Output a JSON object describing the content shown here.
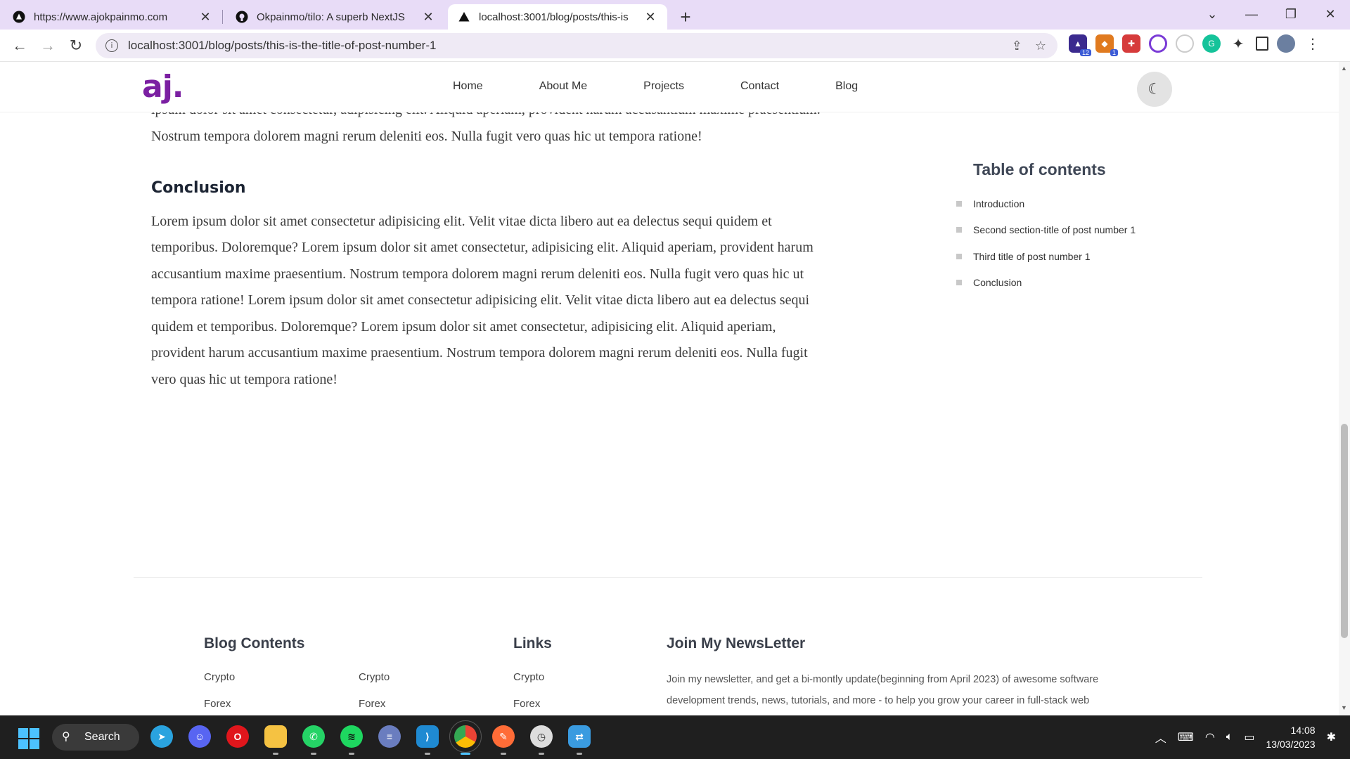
{
  "browser": {
    "tabs": [
      {
        "title": "https://www.ajokpainmo.com",
        "icon": "vercel-icon"
      },
      {
        "title": "Okpainmo/tilo: A superb NextJS",
        "icon": "github-icon"
      },
      {
        "title": "localhost:3001/blog/posts/this-is",
        "icon": "vercel-icon"
      }
    ],
    "url": "localhost:3001/blog/posts/this-is-the-title-of-post-number-1",
    "extension_badges": [
      "12",
      "1"
    ]
  },
  "site": {
    "logo": "aj.",
    "nav": [
      "Home",
      "About Me",
      "Projects",
      "Contact",
      "Blog"
    ]
  },
  "article": {
    "para_top": "ipsum dolor sit amet consectetur, adipisicing elit. Aliquid aperiam, provident harum accusantium maxime praesentium. Nostrum tempora dolorem magni rerum deleniti eos. Nulla fugit vero quas hic ut tempora ratione!",
    "conclusion_heading": "Conclusion",
    "conclusion_text": "Lorem ipsum dolor sit amet consectetur adipisicing elit. Velit vitae dicta libero aut ea delectus sequi quidem et temporibus. Doloremque? Lorem ipsum dolor sit amet consectetur, adipisicing elit. Aliquid aperiam, provident harum accusantium maxime praesentium. Nostrum tempora dolorem magni rerum deleniti eos. Nulla fugit vero quas hic ut tempora ratione! Lorem ipsum dolor sit amet consectetur adipisicing elit. Velit vitae dicta libero aut ea delectus sequi quidem et temporibus. Doloremque? Lorem ipsum dolor sit amet consectetur, adipisicing elit. Aliquid aperiam, provident harum accusantium maxime praesentium. Nostrum tempora dolorem magni rerum deleniti eos. Nulla fugit vero quas hic ut tempora ratione!"
  },
  "toc": {
    "title": "Table of contents",
    "items": [
      "Introduction",
      "Second section-title of post number 1",
      "Third title of post number 1",
      "Conclusion"
    ]
  },
  "footer": {
    "blog_contents_title": "Blog Contents",
    "blog_col1": [
      "Crypto",
      "Forex"
    ],
    "blog_col2": [
      "Crypto",
      "Forex"
    ],
    "links_title": "Links",
    "links": [
      "Crypto",
      "Forex"
    ],
    "newsletter_title": "Join My NewsLetter",
    "newsletter_text": "Join my newsletter, and get a bi-montly update(beginning from April 2023) of awesome software development trends, news, tutorials, and more - to help you grow your career in full-stack web"
  },
  "taskbar": {
    "search_label": "Search",
    "apps": [
      "telegram-icon",
      "discord-icon",
      "opera-icon",
      "file-explorer-icon",
      "whatsapp-icon",
      "spotify-icon",
      "vpn-icon",
      "vscode-icon",
      "chrome-icon",
      "postman-icon",
      "clock-app-icon",
      "remote-desktop-icon"
    ],
    "time": "14:08",
    "date": "13/03/2023"
  },
  "colors": {
    "brand": "#7b1fa2",
    "tabbar": "#e8dcf7",
    "taskbar": "#1f1f1f"
  }
}
